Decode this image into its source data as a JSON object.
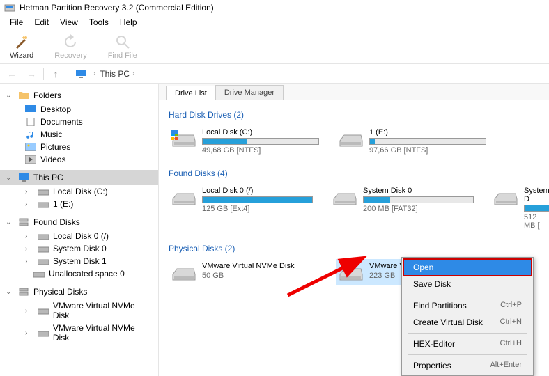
{
  "window": {
    "title": "Hetman Partition Recovery 3.2 (Commercial Edition)"
  },
  "menubar": [
    "File",
    "Edit",
    "View",
    "Tools",
    "Help"
  ],
  "toolbar": [
    {
      "key": "wizard",
      "label": "Wizard",
      "disabled": false
    },
    {
      "key": "recovery",
      "label": "Recovery",
      "disabled": true
    },
    {
      "key": "findfile",
      "label": "Find File",
      "disabled": true
    }
  ],
  "breadcrumb": {
    "root": "This PC"
  },
  "sidebar": {
    "folders": {
      "label": "Folders",
      "items": [
        "Desktop",
        "Documents",
        "Music",
        "Pictures",
        "Videos"
      ]
    },
    "thispc": {
      "label": "This PC",
      "items": [
        "Local Disk (C:)",
        "1 (E:)"
      ]
    },
    "found": {
      "label": "Found Disks",
      "items": [
        "Local Disk 0 (/)",
        "System Disk 0",
        "System Disk 1",
        "Unallocated space 0"
      ]
    },
    "physical": {
      "label": "Physical Disks",
      "items": [
        "VMware Virtual NVMe Disk",
        "VMware Virtual NVMe Disk"
      ]
    }
  },
  "tabs": {
    "drivelist": "Drive List",
    "drivemanager": "Drive Manager"
  },
  "sections": {
    "hard": {
      "title": "Hard Disk Drives (2)",
      "drives": [
        {
          "name": "Local Disk (C:)",
          "sub": "49,68 GB [NTFS]",
          "fill": 38
        },
        {
          "name": "1 (E:)",
          "sub": "97,66 GB [NTFS]",
          "fill": 4
        }
      ]
    },
    "found": {
      "title": "Found Disks (4)",
      "drives": [
        {
          "name": "Local Disk 0 (/)",
          "sub": "125 GB [Ext4]",
          "fill": 100
        },
        {
          "name": "System Disk 0",
          "sub": "200 MB [FAT32]",
          "fill": 24
        },
        {
          "name": "System D",
          "sub": "512 MB [",
          "fill": 100,
          "cut": true
        }
      ]
    },
    "physical": {
      "title": "Physical Disks (2)",
      "drives": [
        {
          "name": "VMware Virtual NVMe Disk",
          "sub": "50 GB",
          "nobar": true
        },
        {
          "name": "VMware Virtual NVMe Disk",
          "sub": "223 GB",
          "nobar": true,
          "selected": true
        }
      ]
    }
  },
  "contextmenu": {
    "items": [
      {
        "label": "Open",
        "shortcut": "",
        "hl": true
      },
      {
        "label": "Save Disk",
        "shortcut": ""
      },
      {
        "sep": true
      },
      {
        "label": "Find Partitions",
        "shortcut": "Ctrl+P"
      },
      {
        "label": "Create Virtual Disk",
        "shortcut": "Ctrl+N"
      },
      {
        "sep": true
      },
      {
        "label": "HEX-Editor",
        "shortcut": "Ctrl+H"
      },
      {
        "sep": true
      },
      {
        "label": "Properties",
        "shortcut": "Alt+Enter"
      }
    ]
  }
}
